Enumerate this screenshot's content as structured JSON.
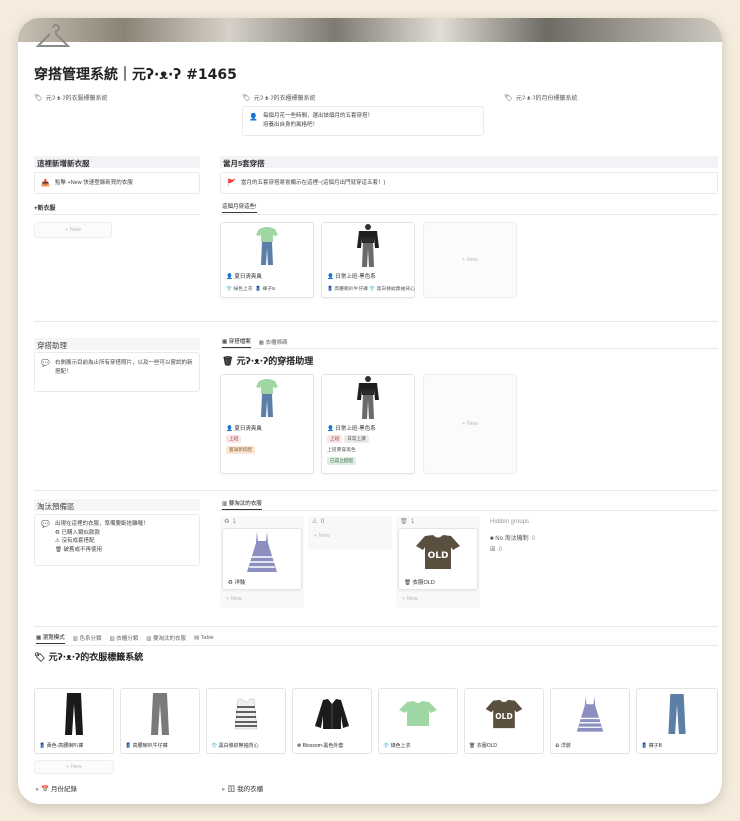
{
  "page": {
    "title": "穿搭管理系統｜元ʔ·ᴥ·ʔ #1465"
  },
  "top_links": {
    "left": "元ʔ·ᴥ·ʔ的衣服標籤系統",
    "middle": "元ʔ·ᴥ·ʔ的衣櫃標籤系統",
    "right": "元ʔ·ᴥ·ʔ的月份標籤系統"
  },
  "intro_callout": {
    "line1": "每個月花一些時間，選出該個月的五套穿搭！",
    "line2": "培養出自身的風格吧！"
  },
  "new_clothes": {
    "heading": "這裡新增新衣服",
    "callout": "點擊 +New 快速登錄新買的衣服",
    "db_label": "+新衣服",
    "new_label": "+ New"
  },
  "monthly": {
    "heading": "當月5套穿搭",
    "callout": "當月的五套穿搭將會顯示在這裡~(這個月出門就穿這五套！)",
    "tab": "這個月穿這些!",
    "cards": [
      {
        "name": "夏日清爽風",
        "meta1": "綠色上衣",
        "meta2": "褲子B"
      },
      {
        "name": "日常上班-黑色系",
        "meta1": "高腰喇叭牛仔褲",
        "meta2": "黑白條紋無袖背心"
      }
    ],
    "new_label": "+ New"
  },
  "assistant": {
    "heading": "穿搭助理",
    "callout": "右側展示目前為止所有穿搭照片，以及一些可以嘗試的新搭配！",
    "tabs": [
      "穿搭檔案",
      "衣櫃條碼"
    ],
    "db_title": "元ʔ·ᴥ·ʔ的穿搭助理",
    "cards": [
      {
        "name": "夏日清爽風",
        "tags": [
          "上班"
        ],
        "status": "嘗試新搭配"
      },
      {
        "name": "日常上班-黑色系",
        "tags": [
          "上班",
          "日常上課"
        ],
        "extra": "上班要穿黑色",
        "status": "已成立搭配"
      }
    ],
    "new_label": "+ New"
  },
  "retire": {
    "heading": "淘汰預備區",
    "callout_title": "出現在這裡的衣服，準備要斷捨離囉！",
    "reasons": [
      "已購入類似款款",
      "沒有成套搭配",
      "破舊或不再使用"
    ],
    "tab": "要淘汰的衣服",
    "columns": [
      {
        "label": "♻",
        "count": "1",
        "item": "洋裝"
      },
      {
        "label": "⚠",
        "count": "0"
      },
      {
        "label": "🗑",
        "count": "1",
        "item": "衣服OLD"
      }
    ],
    "hidden_groups": "Hidden groups",
    "hidden_items": [
      {
        "label": "No 淘汰機制",
        "count": "0"
      },
      {
        "label": "",
        "count": "0"
      }
    ],
    "new_label": "+ New"
  },
  "gallery": {
    "tabs": [
      "瀏覽模式",
      "色系分類",
      "衣櫃分類",
      "要淘汰的衣服",
      "Table"
    ],
    "title": "元ʔ·ᴥ·ʔ的衣服標籤系統",
    "items": [
      "黃色-高腰喇叭褲",
      "高腰喇叭牛仔褲",
      "黑白條紋無袖背心",
      "Blossom-黑色外套",
      "綠色上衣",
      "衣服OLD",
      "洋裝",
      "褲子B"
    ],
    "new_label": "+ New"
  },
  "footer": {
    "left": "月份紀錄",
    "right": "我的衣櫃"
  },
  "colors": {
    "background": "#f5ecdd",
    "section_header": "#f4f1f7",
    "jeans": "#5b7fa6",
    "tshirt_green": "#9fd7a4",
    "tshirt_brown": "#5b4f3f",
    "dress": "#8a8fbf"
  }
}
